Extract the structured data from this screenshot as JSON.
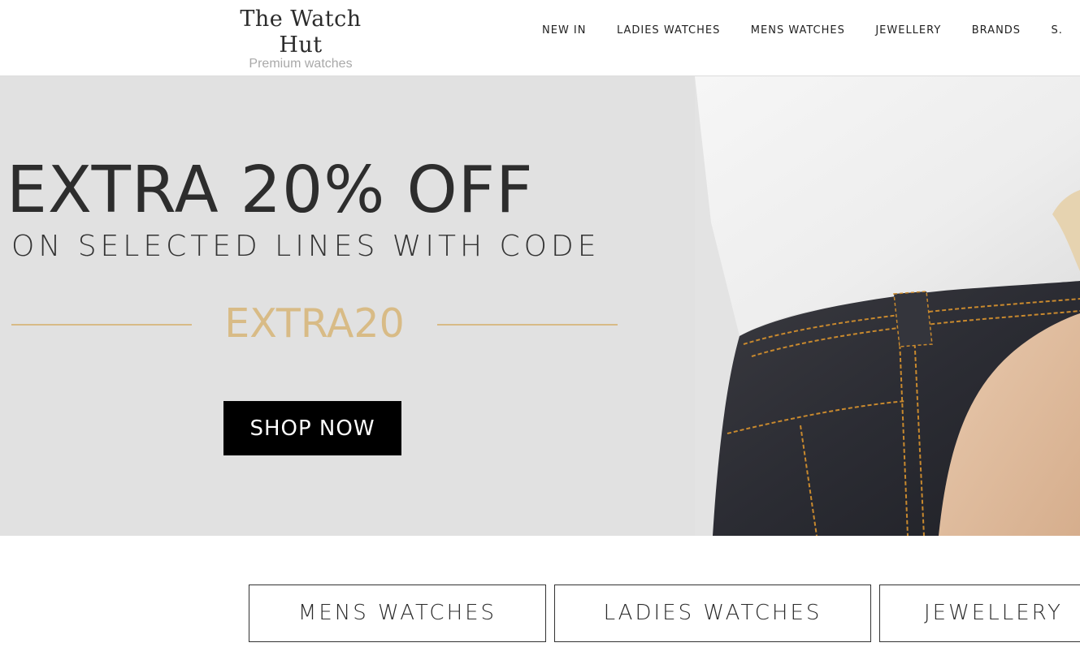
{
  "brand": {
    "name": "The Watch Hut",
    "tagline": "Premium watches"
  },
  "nav": {
    "items": [
      {
        "label": "NEW IN"
      },
      {
        "label": "LADIES WATCHES"
      },
      {
        "label": "MENS WATCHES"
      },
      {
        "label": "JEWELLERY"
      },
      {
        "label": "BRANDS"
      },
      {
        "label": "S."
      }
    ]
  },
  "hero": {
    "headline": "EXTRA 20% OFF",
    "subline": "ON SELECTED LINES WITH CODE",
    "code": "EXTRA20",
    "cta_label": "SHOP NOW"
  },
  "categories": [
    {
      "label": "MENS WATCHES"
    },
    {
      "label": "LADIES WATCHES"
    },
    {
      "label": "JEWELLERY"
    }
  ],
  "colors": {
    "promo_gold": "#d8bb86",
    "hero_background": "#e1e1e1",
    "cta_background": "#000000",
    "text_dark": "#2d2d2d"
  }
}
